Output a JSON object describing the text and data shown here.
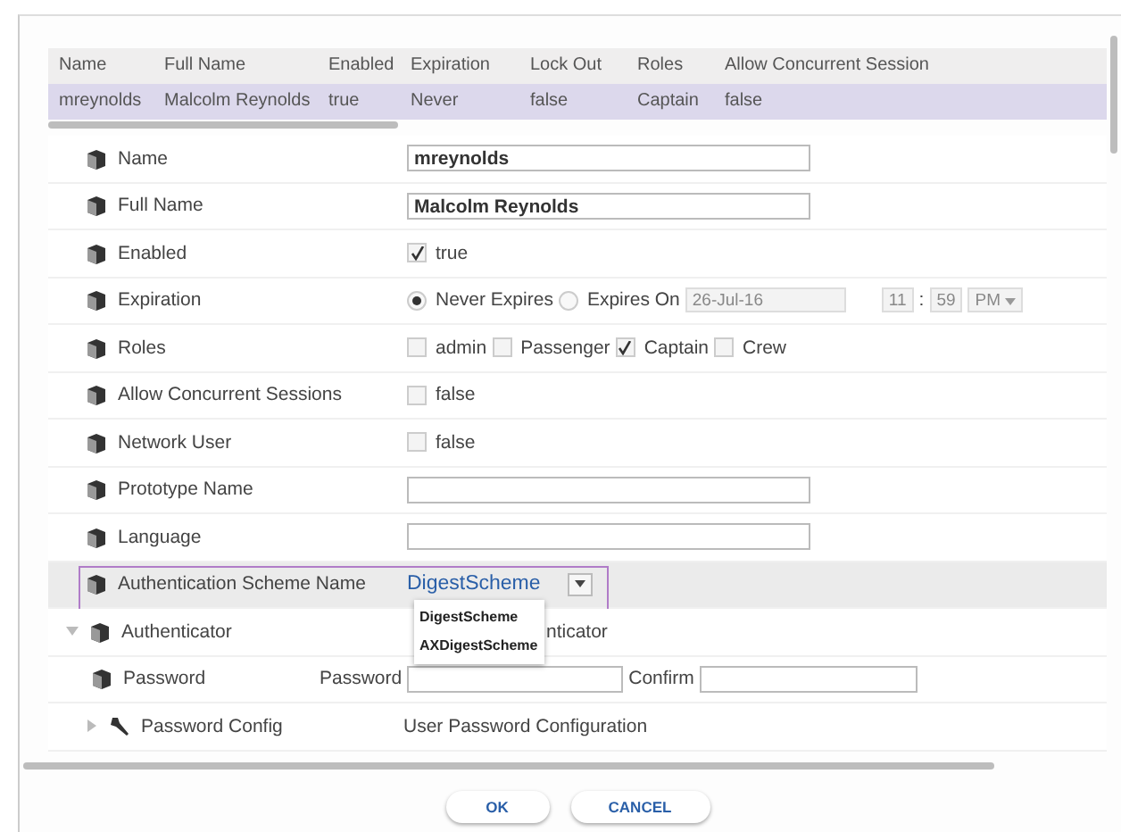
{
  "table": {
    "columns": [
      "Name",
      "Full Name",
      "Enabled",
      "Expiration",
      "Lock Out",
      "Roles",
      "Allow Concurrent Session"
    ],
    "rows": [
      {
        "selected": true,
        "cells": [
          "mreynolds",
          "Malcolm Reynolds",
          "true",
          "Never",
          "false",
          "Captain",
          "false"
        ]
      }
    ]
  },
  "form": {
    "rows": [
      {
        "kind": "text",
        "label": "Name",
        "value": "mreynolds"
      },
      {
        "kind": "text",
        "label": "Full Name",
        "value": "Malcolm Reynolds"
      },
      {
        "kind": "checkbox",
        "label": "Enabled",
        "checked": true,
        "text": "true"
      },
      {
        "kind": "expiration",
        "label": "Expiration",
        "options": [
          {
            "label": "Never Expires",
            "selected": true
          },
          {
            "label": "Expires On",
            "selected": false
          }
        ],
        "date": "26-Jul-16",
        "hour": "11",
        "separator": ":",
        "minute": "59",
        "ampm": "PM",
        "disabled": true
      },
      {
        "kind": "roles",
        "label": "Roles",
        "roles": [
          {
            "label": "admin",
            "checked": false
          },
          {
            "label": "Passenger",
            "checked": false
          },
          {
            "label": "Captain",
            "checked": true
          },
          {
            "label": "Crew",
            "checked": false
          }
        ]
      },
      {
        "kind": "checkbox",
        "label": "Allow Concurrent Sessions",
        "checked": false,
        "text": "false"
      },
      {
        "kind": "checkbox",
        "label": "Network User",
        "checked": false,
        "text": "false"
      },
      {
        "kind": "text",
        "label": "Prototype Name"
      },
      {
        "kind": "text",
        "label": "Language"
      },
      {
        "kind": "select",
        "label": "Authentication Scheme Name",
        "value": "DigestScheme",
        "highlighted": true,
        "menu": [
          "DigestScheme",
          "AXDigestScheme"
        ]
      },
      {
        "kind": "expandable",
        "label": "Authenticator",
        "value": "nticator",
        "expanded": true,
        "children": [
          {
            "kind": "password",
            "label": "Password",
            "prefix": "Password",
            "confirm": "Confirm"
          }
        ]
      },
      {
        "kind": "folder",
        "label": "Password Config",
        "value": "User Password Configuration",
        "expanded": false
      }
    ]
  },
  "buttons": [
    "OK",
    "CANCEL"
  ]
}
